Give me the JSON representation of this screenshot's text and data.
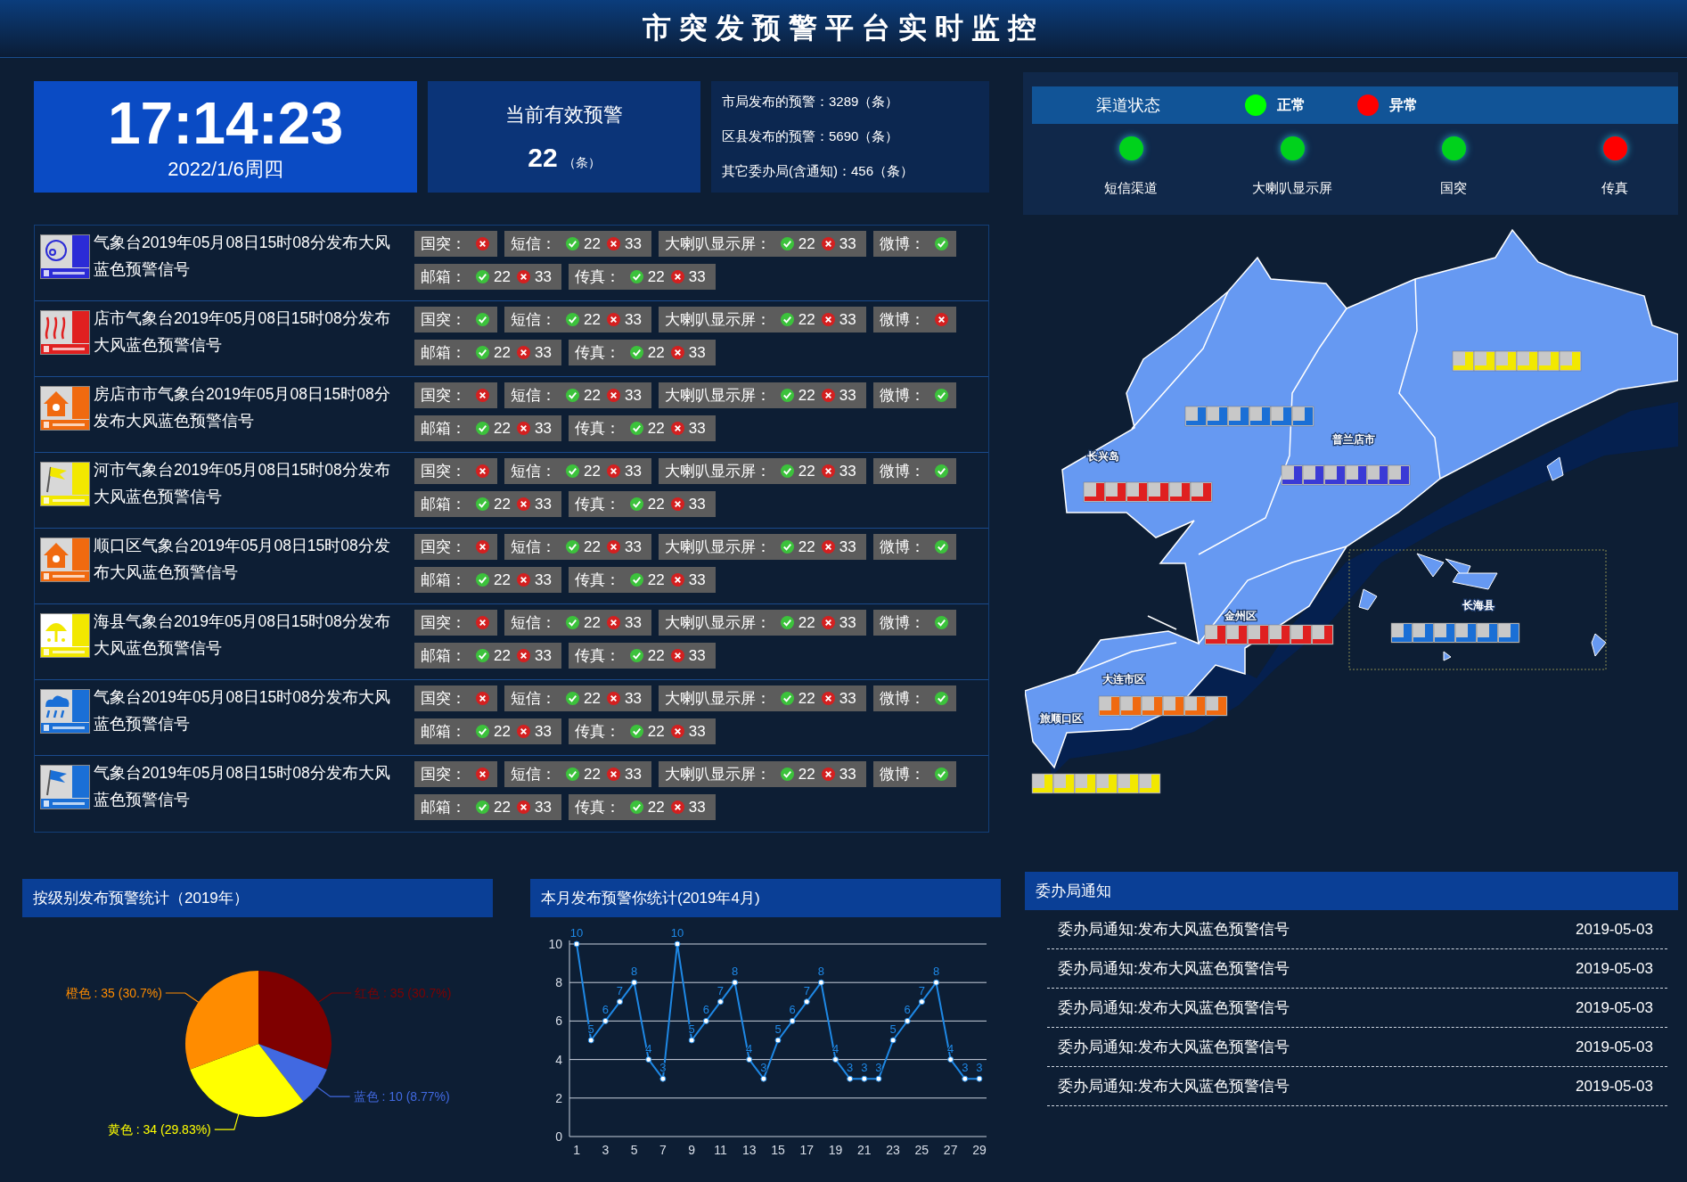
{
  "header": {
    "title": "市突发预警平台实时监控"
  },
  "clock": {
    "time": "17:14:23",
    "date": "2022/1/6周四"
  },
  "active_alerts": {
    "label": "当前有效预警",
    "count": "22",
    "unit": "（条）"
  },
  "stats": [
    "市局发布的预警：3289（条）",
    "区县发布的预警：5690（条）",
    "其它委办局(含通知)：456（条）"
  ],
  "warnings": [
    {
      "kind": "pollution",
      "color": "#2b2bd6",
      "text": "气象台2019年05月08日15时08分发布大风蓝色预警信号",
      "channels": [
        {
          "kind": "status",
          "label": "国突：",
          "ok": false
        },
        {
          "kind": "count",
          "label": "短信：",
          "ok_count": "22",
          "fail_count": "33"
        },
        {
          "kind": "count",
          "label": "大喇叭显示屏：",
          "ok_count": "22",
          "fail_count": "33"
        },
        {
          "kind": "status",
          "label": "微博：",
          "ok": true
        },
        {
          "kind": "count",
          "label": "邮箱：",
          "ok_count": "22",
          "fail_count": "33"
        },
        {
          "kind": "count",
          "label": "传真：",
          "ok_count": "22",
          "fail_count": "33"
        }
      ]
    },
    {
      "kind": "drought",
      "color": "#e02020",
      "text": "店市气象台2019年05月08日15时08分发布大风蓝色预警信号",
      "channels": [
        {
          "kind": "status",
          "label": "国突：",
          "ok": true
        },
        {
          "kind": "count",
          "label": "短信：",
          "ok_count": "22",
          "fail_count": "33"
        },
        {
          "kind": "count",
          "label": "大喇叭显示屏：",
          "ok_count": "22",
          "fail_count": "33"
        },
        {
          "kind": "status",
          "label": "微博：",
          "ok": false
        },
        {
          "kind": "count",
          "label": "邮箱：",
          "ok_count": "22",
          "fail_count": "33"
        },
        {
          "kind": "count",
          "label": "传真：",
          "ok_count": "22",
          "fail_count": "33"
        }
      ]
    },
    {
      "kind": "heat",
      "color": "#f06a10",
      "text": "房店市市气象台2019年05月08日15时08分发布大风蓝色预警信号",
      "channels": [
        {
          "kind": "status",
          "label": "国突：",
          "ok": false
        },
        {
          "kind": "count",
          "label": "短信：",
          "ok_count": "22",
          "fail_count": "33"
        },
        {
          "kind": "count",
          "label": "大喇叭显示屏：",
          "ok_count": "22",
          "fail_count": "33"
        },
        {
          "kind": "status",
          "label": "微博：",
          "ok": true
        },
        {
          "kind": "count",
          "label": "邮箱：",
          "ok_count": "22",
          "fail_count": "33"
        },
        {
          "kind": "count",
          "label": "传真：",
          "ok_count": "22",
          "fail_count": "33"
        }
      ]
    },
    {
      "kind": "gale",
      "color": "#f2e800",
      "text": "河市气象台2019年05月08日15时08分发布大风蓝色预警信号",
      "channels": [
        {
          "kind": "status",
          "label": "国突：",
          "ok": false
        },
        {
          "kind": "count",
          "label": "短信：",
          "ok_count": "22",
          "fail_count": "33"
        },
        {
          "kind": "count",
          "label": "大喇叭显示屏：",
          "ok_count": "22",
          "fail_count": "33"
        },
        {
          "kind": "status",
          "label": "微博：",
          "ok": true
        },
        {
          "kind": "count",
          "label": "邮箱：",
          "ok_count": "22",
          "fail_count": "33"
        },
        {
          "kind": "count",
          "label": "传真：",
          "ok_count": "22",
          "fail_count": "33"
        }
      ]
    },
    {
      "kind": "heat",
      "color": "#f06a10",
      "text": "顺口区气象台2019年05月08日15时08分发布大风蓝色预警信号",
      "channels": [
        {
          "kind": "status",
          "label": "国突：",
          "ok": false
        },
        {
          "kind": "count",
          "label": "短信：",
          "ok_count": "22",
          "fail_count": "33"
        },
        {
          "kind": "count",
          "label": "大喇叭显示屏：",
          "ok_count": "22",
          "fail_count": "33"
        },
        {
          "kind": "status",
          "label": "微博：",
          "ok": true
        },
        {
          "kind": "count",
          "label": "邮箱：",
          "ok_count": "22",
          "fail_count": "33"
        },
        {
          "kind": "count",
          "label": "传真：",
          "ok_count": "22",
          "fail_count": "33"
        }
      ]
    },
    {
      "kind": "hail",
      "color": "#f2e800",
      "text": "海县气象台2019年05月08日15时08分发布大风蓝色预警信号",
      "channels": [
        {
          "kind": "status",
          "label": "国突：",
          "ok": false
        },
        {
          "kind": "count",
          "label": "短信：",
          "ok_count": "22",
          "fail_count": "33"
        },
        {
          "kind": "count",
          "label": "大喇叭显示屏：",
          "ok_count": "22",
          "fail_count": "33"
        },
        {
          "kind": "status",
          "label": "微博：",
          "ok": true
        },
        {
          "kind": "count",
          "label": "邮箱：",
          "ok_count": "22",
          "fail_count": "33"
        },
        {
          "kind": "count",
          "label": "传真：",
          "ok_count": "22",
          "fail_count": "33"
        }
      ]
    },
    {
      "kind": "rainstorm",
      "color": "#1a6fd6",
      "text": "气象台2019年05月08日15时08分发布大风蓝色预警信号",
      "channels": [
        {
          "kind": "status",
          "label": "国突：",
          "ok": false
        },
        {
          "kind": "count",
          "label": "短信：",
          "ok_count": "22",
          "fail_count": "33"
        },
        {
          "kind": "count",
          "label": "大喇叭显示屏：",
          "ok_count": "22",
          "fail_count": "33"
        },
        {
          "kind": "status",
          "label": "微博：",
          "ok": true
        },
        {
          "kind": "count",
          "label": "邮箱：",
          "ok_count": "22",
          "fail_count": "33"
        },
        {
          "kind": "count",
          "label": "传真：",
          "ok_count": "22",
          "fail_count": "33"
        }
      ]
    },
    {
      "kind": "gale",
      "color": "#1a6fd6",
      "text": "气象台2019年05月08日15时08分发布大风蓝色预警信号",
      "channels": [
        {
          "kind": "status",
          "label": "国突：",
          "ok": false
        },
        {
          "kind": "count",
          "label": "短信：",
          "ok_count": "22",
          "fail_count": "33"
        },
        {
          "kind": "count",
          "label": "大喇叭显示屏：",
          "ok_count": "22",
          "fail_count": "33"
        },
        {
          "kind": "status",
          "label": "微博：",
          "ok": true
        },
        {
          "kind": "count",
          "label": "邮箱：",
          "ok_count": "22",
          "fail_count": "33"
        },
        {
          "kind": "count",
          "label": "传真：",
          "ok_count": "22",
          "fail_count": "33"
        }
      ]
    }
  ],
  "level_panel": {
    "title": "按级别发布预警统计（2019年）",
    "chart_data": {
      "type": "pie",
      "categories": [
        "红色",
        "蓝色",
        "黄色",
        "橙色"
      ],
      "values": [
        35,
        10,
        34,
        35
      ],
      "colors": [
        "#7f0000",
        "#4169e1",
        "#ffff00",
        "#ff8c00"
      ],
      "value_labels": [
        ": 35 (30.7%)",
        ": 10 (8.77%)",
        ": 34 (29.83%)",
        ": 35 (30.7%)"
      ]
    }
  },
  "month_panel": {
    "title": "本月发布预警你统计(2019年4月)",
    "chart_data": {
      "type": "line",
      "x": [
        1,
        2,
        3,
        4,
        5,
        6,
        7,
        8,
        9,
        10,
        11,
        12,
        13,
        14,
        15,
        16,
        17,
        18,
        19,
        20,
        21,
        22,
        23,
        24,
        25,
        26,
        27,
        28,
        29
      ],
      "xlim": [
        0.5,
        29.5
      ],
      "ylim": [
        0,
        10
      ],
      "grid": true,
      "xticks": [
        1,
        3,
        5,
        7,
        9,
        11,
        13,
        15,
        17,
        19,
        21,
        23,
        25,
        27,
        29
      ],
      "yticks": [
        0,
        2,
        4,
        6,
        8,
        10
      ],
      "data_labels": true,
      "series": [
        {
          "color": "#1e88e5",
          "marker": "circle",
          "values": [
            10,
            5,
            6,
            7,
            8,
            4,
            3,
            10,
            5,
            6,
            7,
            8,
            4,
            3,
            5,
            6,
            7,
            8,
            4,
            3,
            3,
            3,
            5,
            6,
            7,
            8,
            4,
            3,
            3
          ]
        }
      ]
    }
  },
  "channel_status": {
    "title": "渠道状态",
    "legend": [
      {
        "label": "正常",
        "color": "#00ff00"
      },
      {
        "label": "异常",
        "color": "#ff0000"
      }
    ],
    "channels": [
      {
        "label": "短信渠道",
        "normal": true
      },
      {
        "label": "大喇叭显示屏",
        "normal": true
      },
      {
        "label": "国突",
        "normal": true
      },
      {
        "label": "传真",
        "normal": false
      }
    ]
  },
  "map": {
    "regions": [
      {
        "label": "长兴岛"
      },
      {
        "label": "普兰店市"
      },
      {
        "label": "金州区"
      },
      {
        "label": "长海县"
      },
      {
        "label": "大连市区"
      },
      {
        "label": "旅顺口区"
      }
    ]
  },
  "notices": {
    "title": "委办局通知",
    "items": [
      {
        "text": "委办局通知:发布大风蓝色预警信号",
        "date": "2019-05-03"
      },
      {
        "text": "委办局通知:发布大风蓝色预警信号",
        "date": "2019-05-03"
      },
      {
        "text": "委办局通知:发布大风蓝色预警信号",
        "date": "2019-05-03"
      },
      {
        "text": "委办局通知:发布大风蓝色预警信号",
        "date": "2019-05-03"
      },
      {
        "text": "委办局通知:发布大风蓝色预警信号",
        "date": "2019-05-03"
      }
    ]
  }
}
